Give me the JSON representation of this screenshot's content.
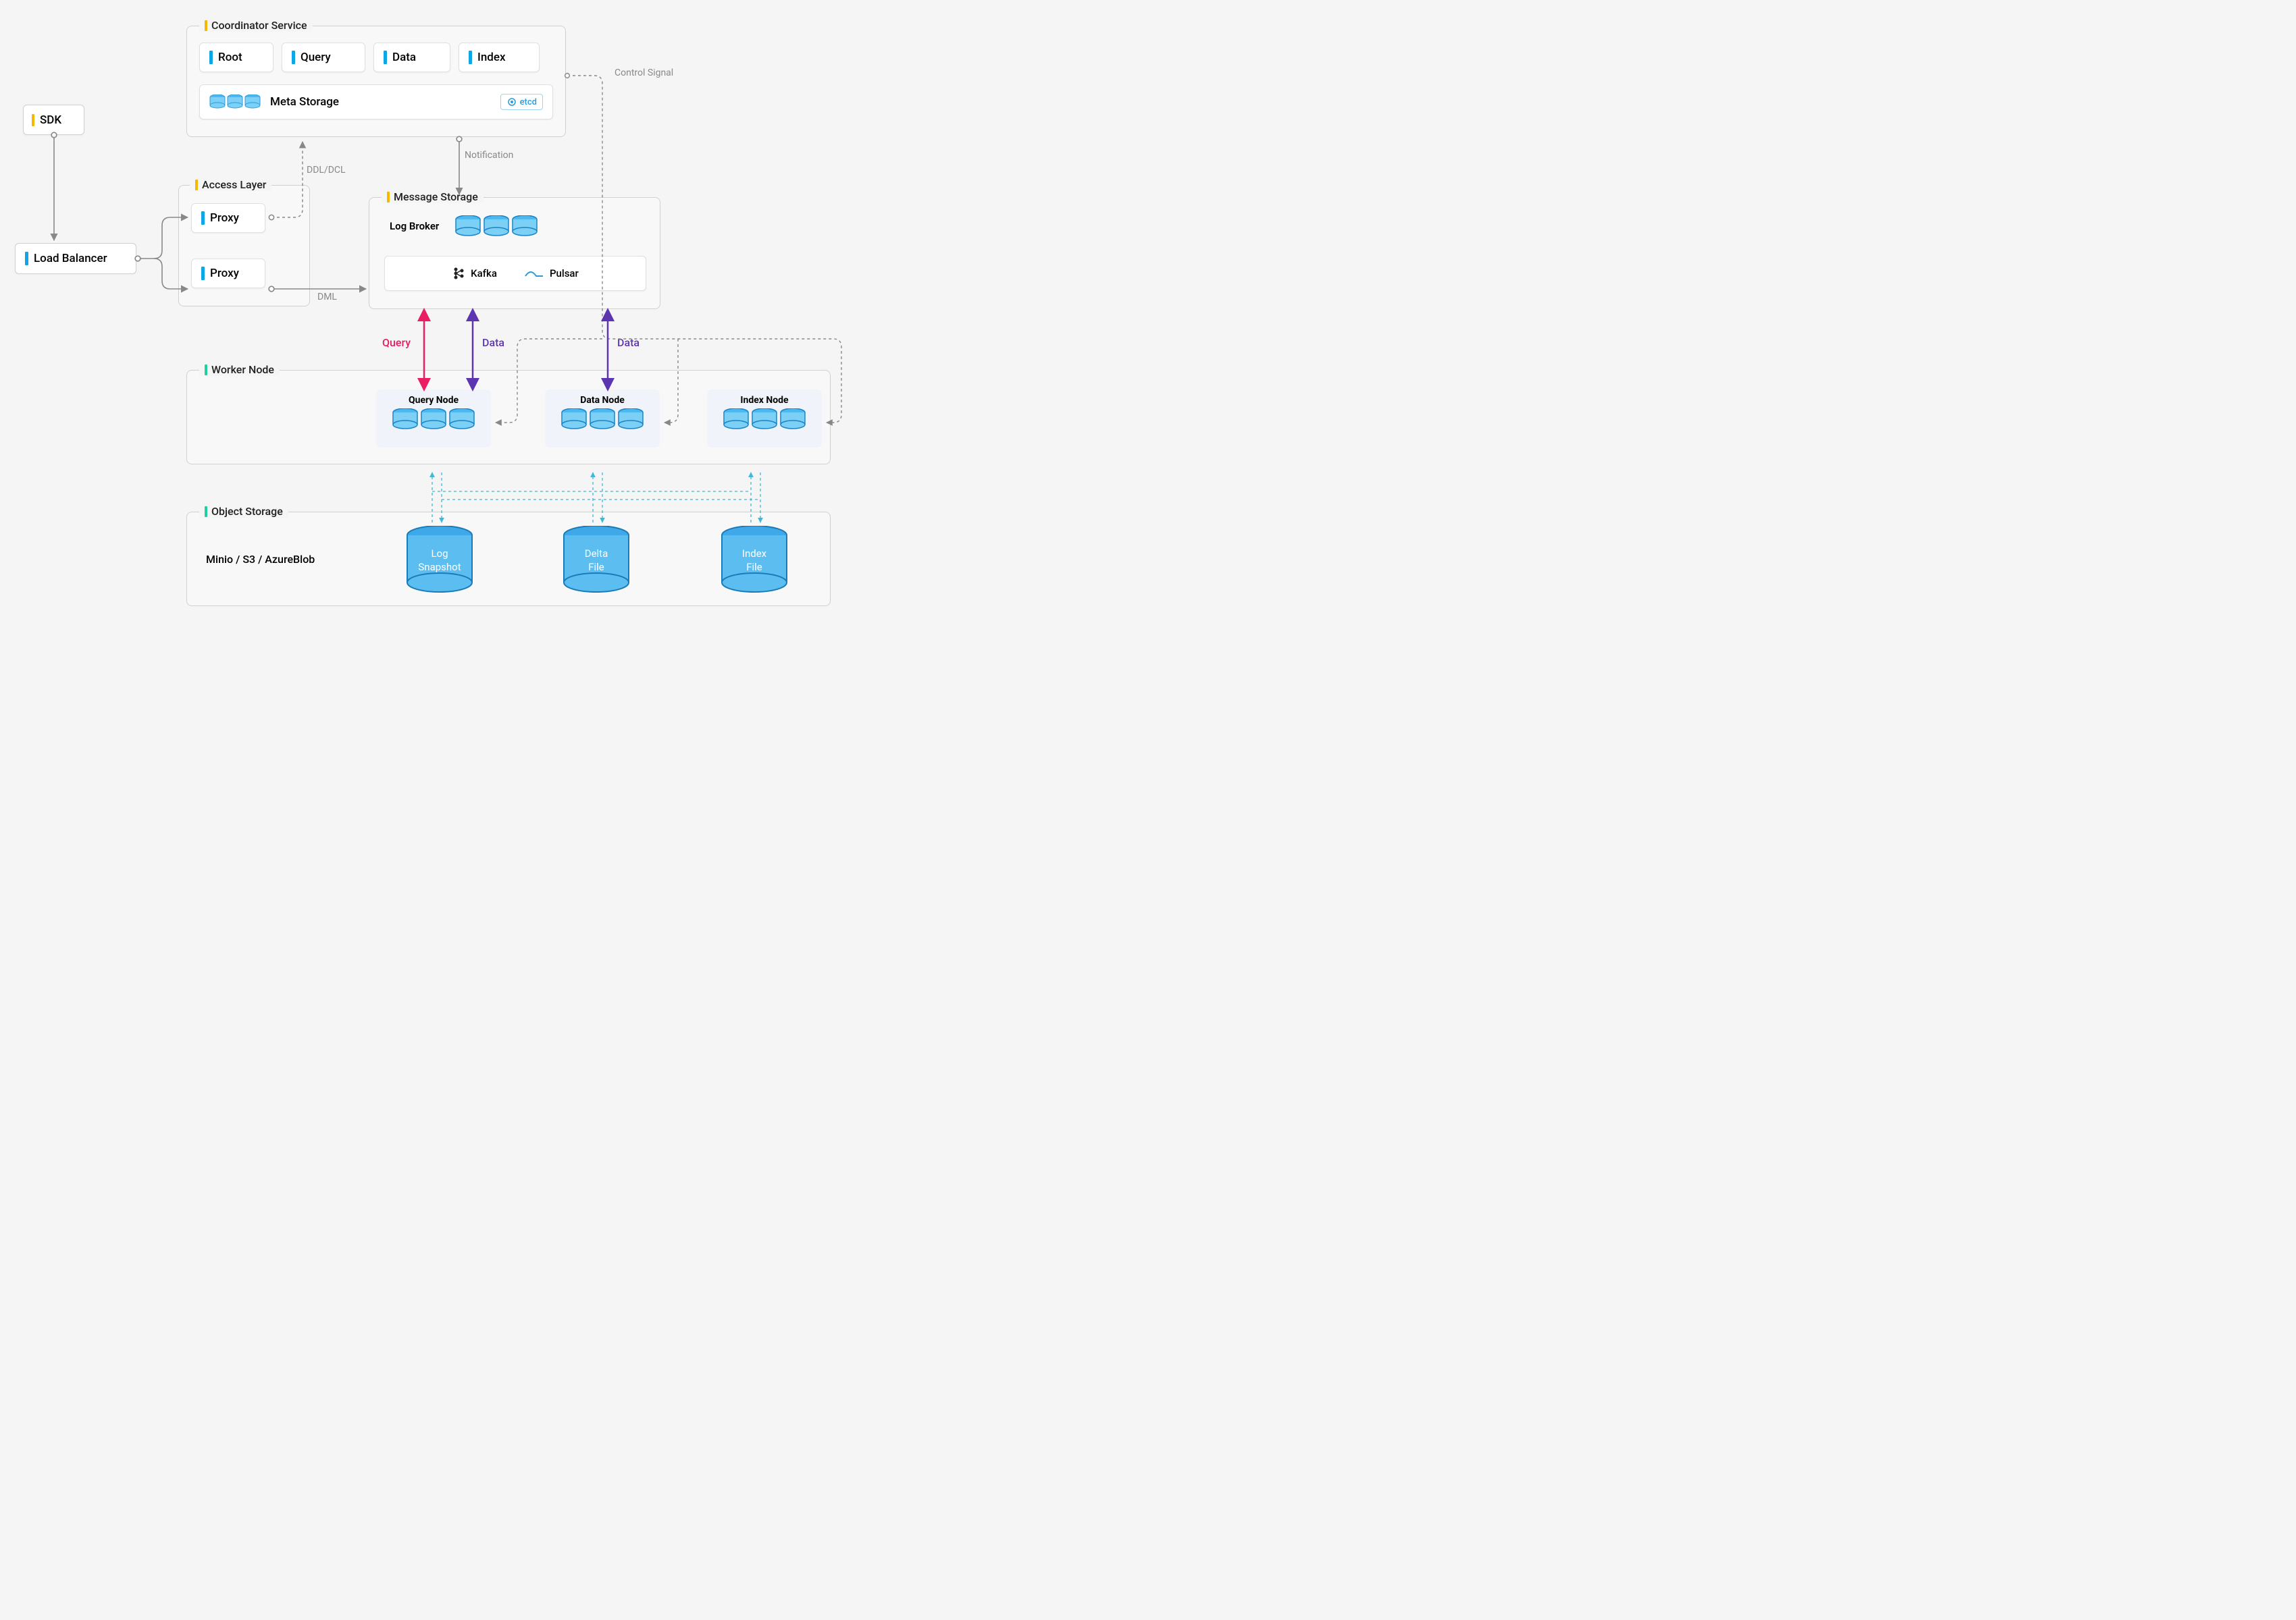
{
  "sdk": {
    "label": "SDK"
  },
  "loadBalancer": {
    "label": "Load Balancer"
  },
  "accessLayer": {
    "title": "Access Layer",
    "proxies": [
      "Proxy",
      "Proxy"
    ]
  },
  "coordinator": {
    "title": "Coordinator Service",
    "items": [
      "Root",
      "Query",
      "Data",
      "Index"
    ],
    "metaStorage": "Meta Storage",
    "etcd": "etcd"
  },
  "messageStorage": {
    "title": "Message Storage",
    "logBroker": "Log Broker",
    "kafka": "Kafka",
    "pulsar": "Pulsar"
  },
  "workerNode": {
    "title": "Worker Node",
    "query": "Query Node",
    "data": "Data Node",
    "index": "Index Node"
  },
  "objectStorage": {
    "title": "Object Storage",
    "providers": "Minio / S3 / AzureBlob",
    "logSnapshot": "Log\nSnapshot",
    "deltaFile": "Delta\nFile",
    "indexFile": "Index\nFile"
  },
  "edges": {
    "ddlDcl": "DDL/DCL",
    "dml": "DML",
    "notification": "Notification",
    "controlSignal": "Control Signal",
    "query": "Query",
    "data": "Data"
  }
}
